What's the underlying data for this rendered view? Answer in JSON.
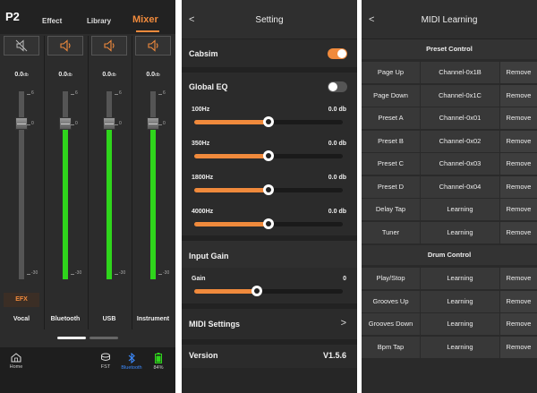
{
  "mixer": {
    "brand": "P2",
    "tabs": [
      "Effect",
      "Library",
      "Mixer"
    ],
    "active_tab": "Mixer",
    "channels": [
      {
        "name": "Vocal",
        "level": "0.0",
        "unit": "db",
        "muted": true,
        "fill_fraction": 0,
        "efx": "EFX"
      },
      {
        "name": "Bluetooth",
        "level": "0.0",
        "unit": "db",
        "muted": false,
        "fill_fraction": 0.86,
        "efx": ""
      },
      {
        "name": "USB",
        "level": "0.0",
        "unit": "db",
        "muted": false,
        "fill_fraction": 0.86,
        "efx": ""
      },
      {
        "name": "Instrument",
        "level": "0.0",
        "unit": "db",
        "muted": false,
        "fill_fraction": 0.86,
        "efx": ""
      }
    ],
    "scale_ticks": [
      "6",
      "0",
      "-30"
    ],
    "bottom_nav": [
      {
        "label": "Home",
        "icon": "home-icon"
      },
      {
        "label": "FST",
        "icon": "fst-icon"
      },
      {
        "label": "Bluetooth",
        "icon": "bluetooth-icon"
      },
      {
        "label": "84%",
        "icon": "battery-icon"
      }
    ],
    "colors": {
      "accent": "#f08a3c",
      "meter": "#2fd51c",
      "bluetooth": "#3d8bff"
    }
  },
  "settings": {
    "title": "Setting",
    "back": "<",
    "cabsim": {
      "label": "Cabsim",
      "on": true
    },
    "global_eq": {
      "label": "Global EQ",
      "on": false,
      "bands": [
        {
          "label": "100Hz",
          "value": "0.0 db",
          "position": 0.5
        },
        {
          "label": "350Hz",
          "value": "0.0 db",
          "position": 0.5
        },
        {
          "label": "1800Hz",
          "value": "0.0 db",
          "position": 0.5
        },
        {
          "label": "4000Hz",
          "value": "0.0 db",
          "position": 0.5
        }
      ]
    },
    "input_gain": {
      "label": "Input Gain",
      "gain_label": "Gain",
      "gain_value": "0",
      "position": 0.42
    },
    "midi_settings": {
      "label": "MIDI Settings",
      "chevron": ">"
    },
    "version": {
      "label": "Version",
      "value": "V1.5.6"
    }
  },
  "midi": {
    "title": "MIDI Learning",
    "back": "<",
    "preset_header": "Preset Control",
    "preset_rows": [
      {
        "name": "Page Up",
        "value": "Channel-0x1B",
        "action": "Remove"
      },
      {
        "name": "Page Down",
        "value": "Channel-0x1C",
        "action": "Remove"
      },
      {
        "name": "Preset A",
        "value": "Channel-0x01",
        "action": "Remove"
      },
      {
        "name": "Preset B",
        "value": "Channel-0x02",
        "action": "Remove"
      },
      {
        "name": "Preset C",
        "value": "Channel-0x03",
        "action": "Remove"
      },
      {
        "name": "Preset D",
        "value": "Channel-0x04",
        "action": "Remove"
      },
      {
        "name": "Delay Tap",
        "value": "Learning",
        "action": "Remove"
      },
      {
        "name": "Tuner",
        "value": "Learning",
        "action": "Remove"
      }
    ],
    "drum_header": "Drum Control",
    "drum_rows": [
      {
        "name": "Play/Stop",
        "value": "Learning",
        "action": "Remove"
      },
      {
        "name": "Grooves Up",
        "value": "Learning",
        "action": "Remove"
      },
      {
        "name": "Grooves Down",
        "value": "Learning",
        "action": "Remove"
      },
      {
        "name": "Bpm Tap",
        "value": "Learning",
        "action": "Remove"
      }
    ]
  }
}
